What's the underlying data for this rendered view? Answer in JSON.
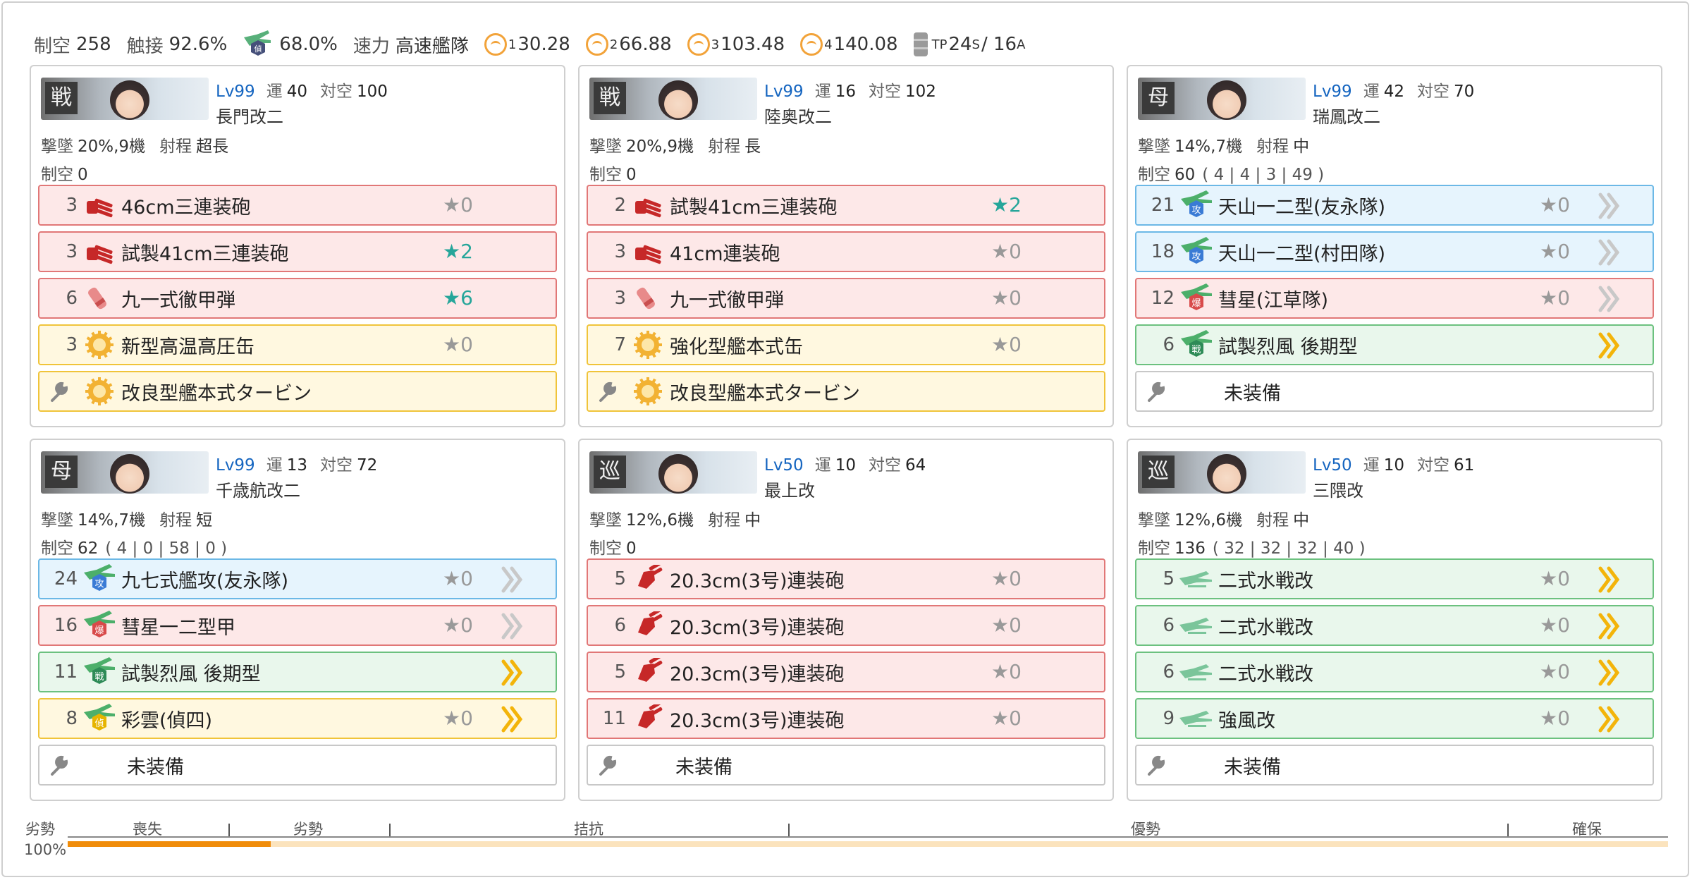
{
  "summary": {
    "air_label": "制空",
    "air_value": "258",
    "contact_label": "触接",
    "contact_value": "92.6%",
    "recon_value": "68.0%",
    "speed_label": "速力",
    "speed_value": "高速艦隊",
    "los": [
      {
        "sub": "1",
        "value": "30.28"
      },
      {
        "sub": "2",
        "value": "66.88"
      },
      {
        "sub": "3",
        "value": "103.48"
      },
      {
        "sub": "4",
        "value": "140.08"
      }
    ],
    "tp_label": "TP",
    "tp_s": "24",
    "tp_s_sub": "S",
    "tp_a": "/ 16",
    "tp_a_sub": "A"
  },
  "labels": {
    "shootdown": "撃墜",
    "range": "射程",
    "air": "制空",
    "luck": "運",
    "aa": "対空",
    "empty": "未装備"
  },
  "colors": {
    "level_blue": "#1565c0",
    "star_teal": "#26a69a",
    "air_fill": "#f08c0a",
    "air_track": "#fbe3bd"
  },
  "ships": [
    {
      "banner_kanji": "戦",
      "level": "Lv99",
      "luck": "40",
      "aa": "100",
      "name": "長門改二",
      "shootdown": "20%,9機",
      "range": "超長",
      "air": "0",
      "slots": "",
      "equips": [
        {
          "count": "3",
          "name": "46cm三連装砲",
          "color": "red",
          "icon": "main-gun-icon",
          "star": "★0",
          "star_hl": false,
          "chev": ""
        },
        {
          "count": "3",
          "name": "試製41cm三連装砲",
          "color": "red",
          "icon": "main-gun-icon",
          "star": "★2",
          "star_hl": true,
          "chev": ""
        },
        {
          "count": "6",
          "name": "九一式徹甲弾",
          "color": "red",
          "icon": "ap-shell-icon",
          "star": "★6",
          "star_hl": true,
          "chev": ""
        },
        {
          "count": "3",
          "name": "新型高温高圧缶",
          "color": "yellow",
          "icon": "boiler-icon",
          "star": "★0",
          "star_hl": false,
          "chev": ""
        },
        {
          "count": "",
          "name": "改良型艦本式タービン",
          "color": "yellow",
          "icon": "turbine-icon",
          "star": "",
          "star_hl": false,
          "chev": "",
          "wrench": true
        }
      ]
    },
    {
      "banner_kanji": "戦",
      "level": "Lv99",
      "luck": "16",
      "aa": "102",
      "name": "陸奥改二",
      "shootdown": "20%,9機",
      "range": "長",
      "air": "0",
      "slots": "",
      "equips": [
        {
          "count": "2",
          "name": "試製41cm三連装砲",
          "color": "red",
          "icon": "main-gun-icon",
          "star": "★2",
          "star_hl": true,
          "chev": ""
        },
        {
          "count": "3",
          "name": "41cm連装砲",
          "color": "red",
          "icon": "main-gun-icon",
          "star": "★0",
          "star_hl": false,
          "chev": ""
        },
        {
          "count": "3",
          "name": "九一式徹甲弾",
          "color": "red",
          "icon": "ap-shell-icon",
          "star": "★0",
          "star_hl": false,
          "chev": ""
        },
        {
          "count": "7",
          "name": "強化型艦本式缶",
          "color": "yellow",
          "icon": "boiler-icon",
          "star": "★0",
          "star_hl": false,
          "chev": ""
        },
        {
          "count": "",
          "name": "改良型艦本式タービン",
          "color": "yellow",
          "icon": "turbine-icon",
          "star": "",
          "star_hl": false,
          "chev": "",
          "wrench": true
        }
      ]
    },
    {
      "banner_kanji": "母",
      "level": "Lv99",
      "luck": "42",
      "aa": "70",
      "name": "瑞鳳改二",
      "shootdown": "14%,7機",
      "range": "中",
      "air": "60",
      "slots": "( 4 | 4 | 3 | 49 )",
      "equips": [
        {
          "count": "21",
          "name": "天山一二型(友永隊)",
          "color": "blue",
          "icon": "torpedo-bomber-icon",
          "star": "★0",
          "star_hl": false,
          "chev": "gray"
        },
        {
          "count": "18",
          "name": "天山一二型(村田隊)",
          "color": "blue",
          "icon": "torpedo-bomber-icon",
          "star": "★0",
          "star_hl": false,
          "chev": "gray"
        },
        {
          "count": "12",
          "name": "彗星(江草隊)",
          "color": "red",
          "icon": "dive-bomber-icon",
          "star": "★0",
          "star_hl": false,
          "chev": "gray"
        },
        {
          "count": "6",
          "name": "試製烈風 後期型",
          "color": "green",
          "icon": "fighter-icon",
          "star": "",
          "star_hl": false,
          "chev": "gold"
        },
        {
          "count": "",
          "name": "未装備",
          "color": "empty",
          "icon": "",
          "star": "",
          "star_hl": false,
          "chev": "",
          "wrench": true
        }
      ]
    },
    {
      "banner_kanji": "母",
      "level": "Lv99",
      "luck": "13",
      "aa": "72",
      "name": "千歳航改二",
      "shootdown": "14%,7機",
      "range": "短",
      "air": "62",
      "slots": "( 4 | 0 | 58 | 0 )",
      "equips": [
        {
          "count": "24",
          "name": "九七式艦攻(友永隊)",
          "color": "blue",
          "icon": "torpedo-bomber-icon",
          "star": "★0",
          "star_hl": false,
          "chev": "gray"
        },
        {
          "count": "16",
          "name": "彗星一二型甲",
          "color": "red",
          "icon": "dive-bomber-icon",
          "star": "★0",
          "star_hl": false,
          "chev": "gray"
        },
        {
          "count": "11",
          "name": "試製烈風 後期型",
          "color": "green",
          "icon": "fighter-icon",
          "star": "",
          "star_hl": false,
          "chev": "gold"
        },
        {
          "count": "8",
          "name": "彩雲(偵四)",
          "color": "yellow",
          "icon": "recon-plane-icon",
          "star": "★0",
          "star_hl": false,
          "chev": "gold"
        },
        {
          "count": "",
          "name": "未装備",
          "color": "empty",
          "icon": "",
          "star": "",
          "star_hl": false,
          "chev": "",
          "wrench": true
        }
      ]
    },
    {
      "banner_kanji": "巡",
      "level": "Lv50",
      "luck": "10",
      "aa": "64",
      "name": "最上改",
      "shootdown": "12%,6機",
      "range": "中",
      "air": "0",
      "slots": "",
      "equips": [
        {
          "count": "5",
          "name": "20.3cm(3号)連装砲",
          "color": "red",
          "icon": "medium-gun-icon",
          "star": "★0",
          "star_hl": false,
          "chev": ""
        },
        {
          "count": "6",
          "name": "20.3cm(3号)連装砲",
          "color": "red",
          "icon": "medium-gun-icon",
          "star": "★0",
          "star_hl": false,
          "chev": ""
        },
        {
          "count": "5",
          "name": "20.3cm(3号)連装砲",
          "color": "red",
          "icon": "medium-gun-icon",
          "star": "★0",
          "star_hl": false,
          "chev": ""
        },
        {
          "count": "11",
          "name": "20.3cm(3号)連装砲",
          "color": "red",
          "icon": "medium-gun-icon",
          "star": "★0",
          "star_hl": false,
          "chev": ""
        },
        {
          "count": "",
          "name": "未装備",
          "color": "empty",
          "icon": "",
          "star": "",
          "star_hl": false,
          "chev": "",
          "wrench": true
        }
      ]
    },
    {
      "banner_kanji": "巡",
      "level": "Lv50",
      "luck": "10",
      "aa": "61",
      "name": "三隈改",
      "shootdown": "12%,6機",
      "range": "中",
      "air": "136",
      "slots": "( 32 | 32 | 32 | 40 )",
      "equips": [
        {
          "count": "5",
          "name": "二式水戦改",
          "color": "green",
          "icon": "seaplane-fighter-icon",
          "star": "★0",
          "star_hl": false,
          "chev": "gold"
        },
        {
          "count": "6",
          "name": "二式水戦改",
          "color": "green",
          "icon": "seaplane-fighter-icon",
          "star": "★0",
          "star_hl": false,
          "chev": "gold"
        },
        {
          "count": "6",
          "name": "二式水戦改",
          "color": "green",
          "icon": "seaplane-fighter-icon",
          "star": "★0",
          "star_hl": false,
          "chev": "gold"
        },
        {
          "count": "9",
          "name": "強風改",
          "color": "green",
          "icon": "seaplane-fighter-icon",
          "star": "★0",
          "star_hl": false,
          "chev": "gold"
        },
        {
          "count": "",
          "name": "未装備",
          "color": "empty",
          "icon": "",
          "star": "",
          "star_hl": false,
          "chev": "",
          "wrench": true
        }
      ]
    }
  ],
  "airbar": {
    "left_top": "劣勢",
    "left_bottom": "100%",
    "segments": [
      "喪失",
      "劣勢",
      "拮抗",
      "優勢",
      "確保"
    ],
    "fill_fraction": 0.127
  }
}
